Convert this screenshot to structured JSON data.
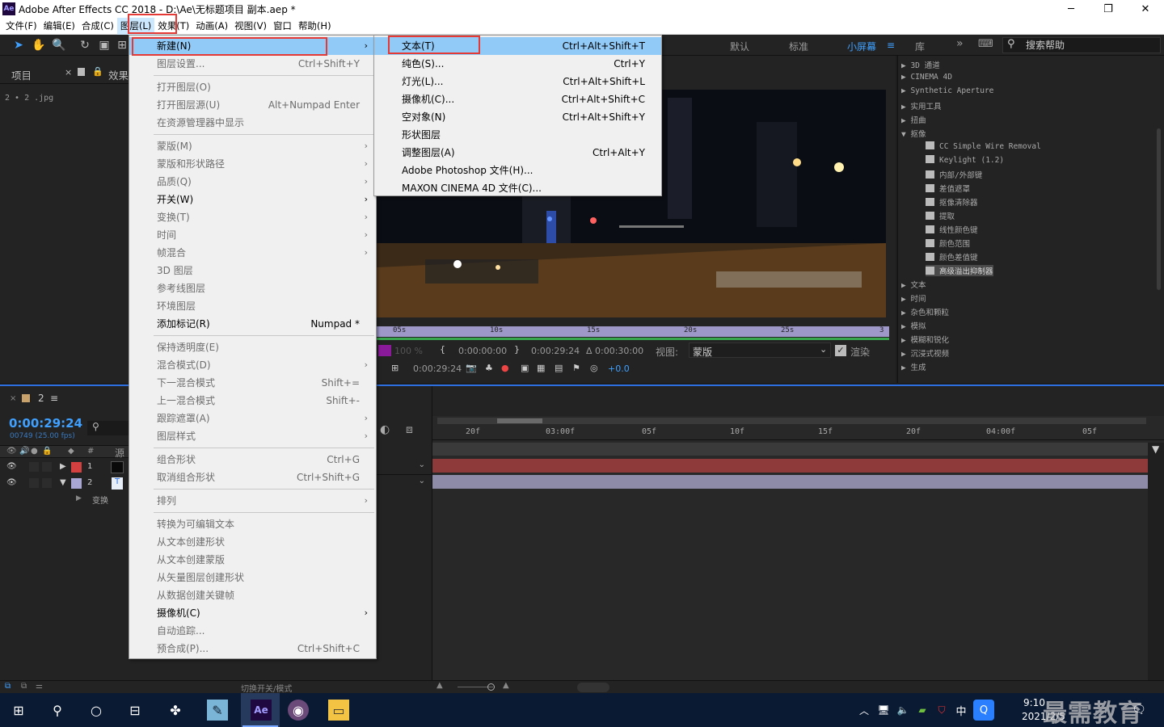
{
  "window": {
    "title": "Adobe After Effects CC 2018 - D:\\Ae\\无标题项目 副本.aep *",
    "logo": "Ae",
    "minimize": "─",
    "maximize": "❐",
    "close": "✕"
  },
  "menubar": [
    {
      "label": "文件(F)"
    },
    {
      "label": "编辑(E)"
    },
    {
      "label": "合成(C)"
    },
    {
      "label": "图层(L)"
    },
    {
      "label": "效果(T)"
    },
    {
      "label": "动画(A)"
    },
    {
      "label": "视图(V)"
    },
    {
      "label": "窗口"
    },
    {
      "label": "帮助(H)"
    }
  ],
  "toolbar": {
    "workspaces": [
      "默认",
      "标准",
      "小屏幕",
      "库"
    ],
    "active_workspace": "小屏幕",
    "help_placeholder": "搜索帮助"
  },
  "project": {
    "tab_project": "项目",
    "tab_effects": "效果",
    "item": "2 • 2 .jpg"
  },
  "viewer": {
    "ruler": [
      "05s",
      "10s",
      "15s",
      "20s",
      "25s",
      "3"
    ],
    "zoom": "100 %",
    "start_time": "0:00:00:00",
    "end_time": "0:00:29:24",
    "duration": "Δ 0:00:30:00",
    "view_label": "视图:",
    "view_value": "蒙版",
    "render_label": "渲染",
    "current_time": "0:00:29:24",
    "exposure": "+0.0"
  },
  "effects_list": [
    {
      "label": "▶ 3D 通道",
      "icon": false
    },
    {
      "label": "▶ CINEMA 4D",
      "icon": false
    },
    {
      "label": "▶ Synthetic Aperture",
      "icon": false
    },
    {
      "label": "▶ 实用工具",
      "icon": false
    },
    {
      "label": "▶ 扭曲",
      "icon": false
    },
    {
      "label": "▼ 抠像",
      "icon": false
    },
    {
      "label": "CC Simple Wire Removal",
      "icon": true
    },
    {
      "label": "Keylight (1.2)",
      "icon": true
    },
    {
      "label": "内部/外部键",
      "icon": true
    },
    {
      "label": "差值遮罩",
      "icon": true
    },
    {
      "label": "抠像清除器",
      "icon": true
    },
    {
      "label": "提取",
      "icon": true
    },
    {
      "label": "线性颜色键",
      "icon": true
    },
    {
      "label": "颜色范围",
      "icon": true
    },
    {
      "label": "颜色差值键",
      "icon": true
    },
    {
      "label": "高级溢出抑制器",
      "icon": true,
      "selected": true
    },
    {
      "label": "▶ 文本",
      "icon": false
    },
    {
      "label": "▶ 时间",
      "icon": false
    },
    {
      "label": "▶ 杂色和颗粒",
      "icon": false
    },
    {
      "label": "▶ 模拟",
      "icon": false
    },
    {
      "label": "▶ 模糊和锐化",
      "icon": false
    },
    {
      "label": "▶ 沉浸式视频",
      "icon": false
    },
    {
      "label": "▶ 生成",
      "icon": false
    }
  ],
  "timeline": {
    "comp_name": "2",
    "timecode": "0:00:29:24",
    "frames": "00749 (25.00 fps)",
    "ruler": [
      "20f",
      "03:00f",
      "05f",
      "10f",
      "15f",
      "20f",
      "04:00f",
      "05f"
    ],
    "col_num": "#",
    "col_source": "源",
    "layers": [
      {
        "num": "1",
        "color": "#d43f3f"
      },
      {
        "num": "2",
        "color": "#a9a6d6"
      }
    ],
    "transform": "变换",
    "switch_mode": "切换开关/模式"
  },
  "layer_menu": [
    {
      "label": "新建(N)",
      "shortcut": "",
      "submenu": true,
      "disabled": false,
      "highlight": true
    },
    {
      "label": "图层设置...",
      "shortcut": "Ctrl+Shift+Y",
      "submenu": false,
      "disabled": true
    },
    {
      "sep": true
    },
    {
      "label": "打开图层(O)",
      "shortcut": "",
      "disabled": true
    },
    {
      "label": "打开图层源(U)",
      "shortcut": "Alt+Numpad Enter",
      "disabled": true
    },
    {
      "label": "在资源管理器中显示",
      "shortcut": "",
      "disabled": true
    },
    {
      "sep": true
    },
    {
      "label": "蒙版(M)",
      "shortcut": "",
      "submenu": true,
      "disabled": true
    },
    {
      "label": "蒙版和形状路径",
      "shortcut": "",
      "submenu": true,
      "disabled": true
    },
    {
      "label": "品质(Q)",
      "shortcut": "",
      "submenu": true,
      "disabled": true
    },
    {
      "label": "开关(W)",
      "shortcut": "",
      "submenu": true,
      "disabled": false
    },
    {
      "label": "变换(T)",
      "shortcut": "",
      "submenu": true,
      "disabled": true
    },
    {
      "label": "时间",
      "shortcut": "",
      "submenu": true,
      "disabled": true
    },
    {
      "label": "帧混合",
      "shortcut": "",
      "submenu": true,
      "disabled": true
    },
    {
      "label": "3D 图层",
      "shortcut": "",
      "disabled": true
    },
    {
      "label": "参考线图层",
      "shortcut": "",
      "disabled": true
    },
    {
      "label": "环境图层",
      "shortcut": "",
      "disabled": true
    },
    {
      "label": "添加标记(R)",
      "shortcut": "Numpad *",
      "disabled": false
    },
    {
      "sep": true
    },
    {
      "label": "保持透明度(E)",
      "shortcut": "",
      "disabled": true
    },
    {
      "label": "混合模式(D)",
      "shortcut": "",
      "submenu": true,
      "disabled": true
    },
    {
      "label": "下一混合模式",
      "shortcut": "Shift+=",
      "disabled": true
    },
    {
      "label": "上一混合模式",
      "shortcut": "Shift+-",
      "disabled": true
    },
    {
      "label": "跟踪遮罩(A)",
      "shortcut": "",
      "submenu": true,
      "disabled": true
    },
    {
      "label": "图层样式",
      "shortcut": "",
      "submenu": true,
      "disabled": true
    },
    {
      "sep": true
    },
    {
      "label": "组合形状",
      "shortcut": "Ctrl+G",
      "disabled": true
    },
    {
      "label": "取消组合形状",
      "shortcut": "Ctrl+Shift+G",
      "disabled": true
    },
    {
      "sep": true
    },
    {
      "label": "排列",
      "shortcut": "",
      "submenu": true,
      "disabled": true
    },
    {
      "sep": true
    },
    {
      "label": "转换为可编辑文本",
      "shortcut": "",
      "disabled": true
    },
    {
      "label": "从文本创建形状",
      "shortcut": "",
      "disabled": true
    },
    {
      "label": "从文本创建蒙版",
      "shortcut": "",
      "disabled": true
    },
    {
      "label": "从矢量图层创建形状",
      "shortcut": "",
      "disabled": true
    },
    {
      "label": "从数据创建关键帧",
      "shortcut": "",
      "disabled": true
    },
    {
      "label": "摄像机(C)",
      "shortcut": "",
      "submenu": true,
      "disabled": false
    },
    {
      "label": "自动追踪...",
      "shortcut": "",
      "disabled": true
    },
    {
      "label": "预合成(P)...",
      "shortcut": "Ctrl+Shift+C",
      "disabled": true
    }
  ],
  "new_menu": [
    {
      "label": "文本(T)",
      "shortcut": "Ctrl+Alt+Shift+T",
      "highlight": true
    },
    {
      "label": "纯色(S)...",
      "shortcut": "Ctrl+Y"
    },
    {
      "label": "灯光(L)...",
      "shortcut": "Ctrl+Alt+Shift+L"
    },
    {
      "label": "摄像机(C)...",
      "shortcut": "Ctrl+Alt+Shift+C"
    },
    {
      "label": "空对象(N)",
      "shortcut": "Ctrl+Alt+Shift+Y"
    },
    {
      "label": "形状图层",
      "shortcut": ""
    },
    {
      "label": "调整图层(A)",
      "shortcut": "Ctrl+Alt+Y"
    },
    {
      "label": "Adobe Photoshop 文件(H)...",
      "shortcut": ""
    },
    {
      "label": "MAXON CINEMA 4D 文件(C)...",
      "shortcut": ""
    }
  ],
  "taskbar": {
    "time": "9:10",
    "date": "2021/2/5",
    "ime": "中",
    "app_ae": "Ae",
    "watermark": "最需教育"
  },
  "colors": {
    "accent": "#2d6fe0",
    "highlight": "#91c9f7",
    "redbox": "#e53935"
  }
}
